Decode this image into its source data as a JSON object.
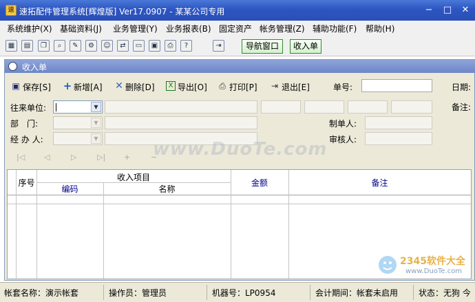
{
  "window": {
    "title": "速拓配件管理系统[辉煌版] Ver17.0907  -  某某公司专用",
    "app_icon": "app-logo-icon"
  },
  "window_controls": {
    "minimize": "−",
    "maximize": "□",
    "close": "✕"
  },
  "menu": [
    "系统维护(X)",
    "基础资料(J)",
    "业务管理(Y)",
    "业务报表(B)",
    "固定资产",
    "帐务管理(Z)",
    "辅助功能(F)",
    "帮助(H)"
  ],
  "toolbar": {
    "icons": [
      "grid-icon",
      "card-icon",
      "windows-icon",
      "search-doc-icon",
      "edit-icon",
      "tools-icon",
      "users-icon",
      "transfer-icon",
      "folder-icon",
      "save-icon",
      "print-icon",
      "help-icon",
      "exit-icon"
    ],
    "nav_window": "导航窗口",
    "receipt": "收入单"
  },
  "subwindow": {
    "title": "收入单"
  },
  "actions": {
    "save": "保存[S]",
    "add": "新增[A]",
    "delete": "删除[D]",
    "export": "导出[O]",
    "print": "打印[P]",
    "exit": "退出[E]"
  },
  "form": {
    "bill_no_label": "单号:",
    "date_label": "日期:",
    "partner_label": "往来单位:",
    "remark_label": "备注:",
    "dept_label": "部　门:",
    "maker_label": "制单人:",
    "handler_label": "经 办 人:",
    "reviewer_label": "审核人:"
  },
  "grid": {
    "headers": {
      "seq": "序号",
      "group": "收入项目",
      "code": "编码",
      "name": "名称",
      "amount": "金额",
      "remark": "备注"
    }
  },
  "watermark": "www.DuoTe.com",
  "brand": {
    "name": "2345软件大全",
    "url": "www.DuoTe.com"
  },
  "status": {
    "account_set": "帐套名称：演示帐套",
    "operator": "操作员：管理员",
    "machine": "机器号：LP0954",
    "period": "会计期间：帐套未启用",
    "state": "状态：无狗 今"
  }
}
